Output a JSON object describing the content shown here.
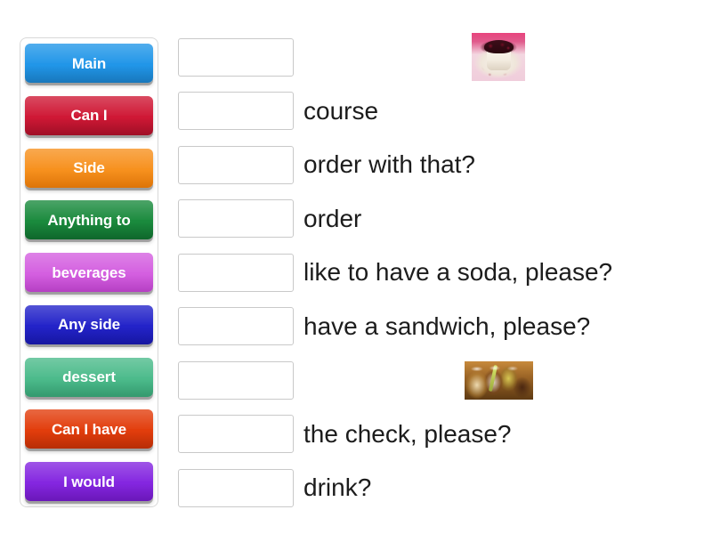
{
  "activity": {
    "type": "match-up",
    "instruction_visible": false
  },
  "tiles": [
    {
      "label": "Main",
      "color": "#2196e8",
      "color_dark": "#1877bb"
    },
    {
      "label": "Can I",
      "color": "#cf1835",
      "color_dark": "#9f0f26"
    },
    {
      "label": "Side",
      "color": "#f7911e",
      "color_dark": "#dd7408"
    },
    {
      "label": "Anything to",
      "color": "#1a8a3d",
      "color_dark": "#0f662b"
    },
    {
      "label": "beverages",
      "color": "#d45fe0",
      "color_dark": "#b53fc3"
    },
    {
      "label": "Any side",
      "color": "#2323c9",
      "color_dark": "#1616a0"
    },
    {
      "label": "dessert",
      "color": "#4cbb8b",
      "color_dark": "#33996e"
    },
    {
      "label": "Can I have",
      "color": "#e23d0c",
      "color_dark": "#b72d06"
    },
    {
      "label": "I would",
      "color": "#8426e0",
      "color_dark": "#6a17b8"
    }
  ],
  "rows": [
    {
      "dropzone_value": "",
      "answer_kind": "image",
      "answer_text": "",
      "image_name": "dessert-photo"
    },
    {
      "dropzone_value": "",
      "answer_kind": "text",
      "answer_text": "course"
    },
    {
      "dropzone_value": "",
      "answer_kind": "text",
      "answer_text": "order with that?"
    },
    {
      "dropzone_value": "",
      "answer_kind": "text",
      "answer_text": "order"
    },
    {
      "dropzone_value": "",
      "answer_kind": "text",
      "answer_text": "like to have a soda, please?"
    },
    {
      "dropzone_value": "",
      "answer_kind": "text",
      "answer_text": "have a sandwich, please?"
    },
    {
      "dropzone_value": "",
      "answer_kind": "image",
      "answer_text": "",
      "image_name": "drinks-photo"
    },
    {
      "dropzone_value": "",
      "answer_kind": "text",
      "answer_text": "the check, please?"
    },
    {
      "dropzone_value": "",
      "answer_kind": "text",
      "answer_text": "drink?"
    }
  ],
  "colors": {
    "page_background": "#ffffff",
    "panel_border": "#d8d8d8",
    "dropzone_border": "#c9c9c9",
    "answer_text": "#1c1c1c",
    "tile_text": "#ffffff"
  }
}
